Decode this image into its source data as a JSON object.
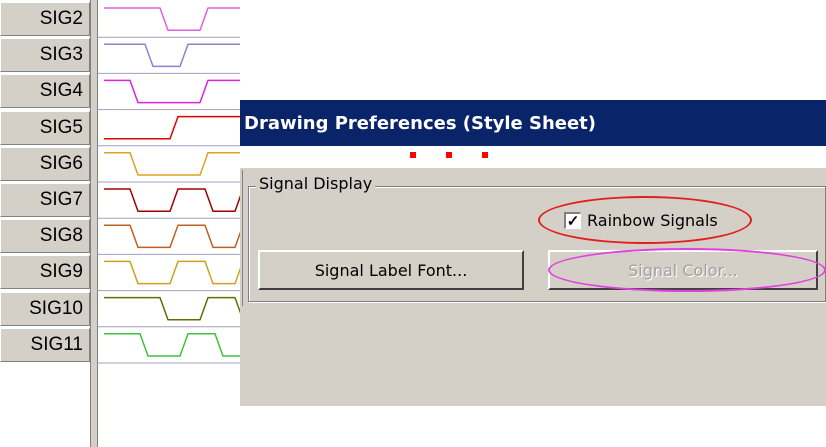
{
  "signals": [
    {
      "name": "SIG2",
      "color": "#e060e0"
    },
    {
      "name": "SIG3",
      "color": "#9080d0"
    },
    {
      "name": "SIG4",
      "color": "#e020e0"
    },
    {
      "name": "SIG5",
      "color": "#e00000"
    },
    {
      "name": "SIG6",
      "color": "#e0a020"
    },
    {
      "name": "SIG7",
      "color": "#a00000"
    },
    {
      "name": "SIG8",
      "color": "#c06020"
    },
    {
      "name": "SIG9",
      "color": "#d0a020"
    },
    {
      "name": "SIG10",
      "color": "#607000"
    },
    {
      "name": "SIG11",
      "color": "#40c040"
    }
  ],
  "dialog": {
    "title": "Drawing Preferences (Style Sheet)",
    "group_title": "Signal Display",
    "rainbow": {
      "label": "Rainbow Signals",
      "checked": true,
      "check_glyph": "✓"
    },
    "font_button_label": "Signal Label Font...",
    "color_button_label": "Signal Color...",
    "color_button_enabled": false
  },
  "annotations": {
    "rainbow_ellipse_color": "#e02020",
    "color_ellipse_color": "#e040e0",
    "dots_color": "#ff0000"
  }
}
